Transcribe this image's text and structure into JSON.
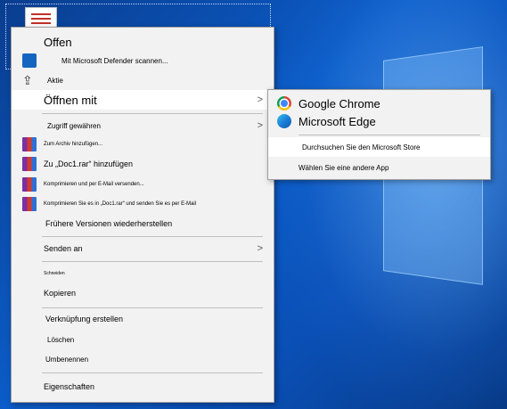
{
  "context_menu": {
    "items": {
      "open": "Offen",
      "defender": "Mit Microsoft Defender scannen...",
      "share": "Aktie",
      "open_with": "Öffnen mit",
      "grant_access": "Zugriff gewähren",
      "add_archive": "Zum Archiv hinzufügen...",
      "add_rar": "Zu „Doc1.rar“ hinzufügen",
      "compress_email": "Komprimieren und per E-Mail versenden...",
      "compress_rar_email": "Komprimieren Sie es in „Doc1.rar“ und senden Sie es per E-Mail",
      "previous_versions": "Frühere Versionen wiederherstellen",
      "send_to": "Senden an",
      "cut": "Schneiden",
      "copy": "Kopieren",
      "create_shortcut": "Verknüpfung erstellen",
      "delete": "Löschen",
      "rename": "Umbenennen",
      "properties": "Eigenschaften"
    },
    "submenu_arrow": ">"
  },
  "open_with_submenu": {
    "items": {
      "chrome": "Google Chrome",
      "edge": "Microsoft Edge",
      "store": "Durchsuchen Sie den Microsoft Store",
      "other_app": "Wählen Sie eine andere App"
    }
  }
}
